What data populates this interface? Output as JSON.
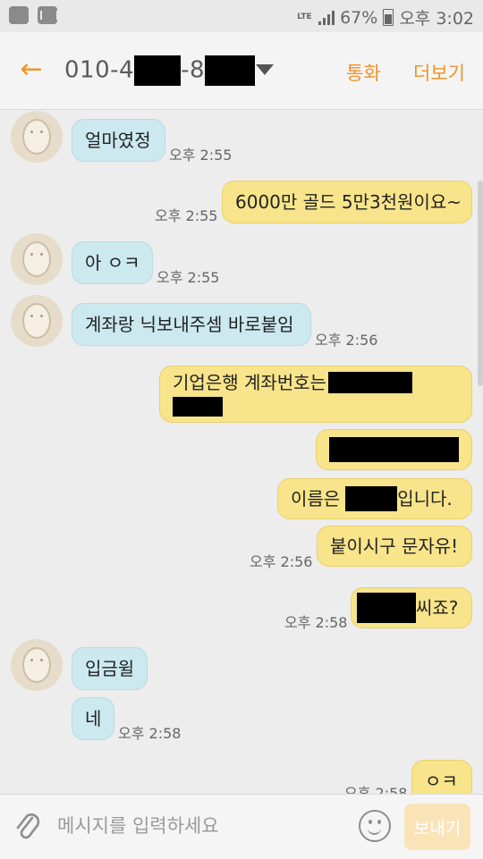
{
  "status_bar": {
    "network": "LTE",
    "battery": "67%",
    "time": "오후 3:02"
  },
  "header": {
    "phone_prefix": "010-4",
    "phone_mid": "-8",
    "call_label": "통화",
    "more_label": "더보기"
  },
  "messages": [
    {
      "dir": "in",
      "text": "얼마였정",
      "time": "오후 2:55"
    },
    {
      "dir": "out",
      "text": "6000만 골드 5만3천원이요~",
      "time": "오후 2:55"
    },
    {
      "dir": "in",
      "text": "아 ㅇㅋ",
      "time": "오후 2:55"
    },
    {
      "dir": "in",
      "text": "계좌랑 닉보내주셈 바로붙임",
      "time": "오후 2:56"
    },
    {
      "dir": "out",
      "text": "기업은행 계좌번호는",
      "time": ""
    },
    {
      "dir": "out",
      "text": "",
      "time": ""
    },
    {
      "dir": "out",
      "text_before": "이름은",
      "text_after": "입니다.",
      "time": ""
    },
    {
      "dir": "out",
      "text": "붙이시구 문자유!",
      "time": "오후 2:56"
    },
    {
      "dir": "out",
      "text": "씨죠?",
      "time": "오후 2:58"
    },
    {
      "dir": "in",
      "text": "입금윌",
      "time": ""
    },
    {
      "dir": "in",
      "text": "네",
      "time": "오후 2:58"
    },
    {
      "dir": "out",
      "text": "ㅇㅋ",
      "time": "오후 2:58"
    }
  ],
  "input": {
    "placeholder": "메시지를 입력하세요",
    "send_label": "보내기"
  },
  "colors": {
    "accent": "#f0942a",
    "incoming": "#cbe9ef",
    "outgoing": "#f8e48a"
  }
}
